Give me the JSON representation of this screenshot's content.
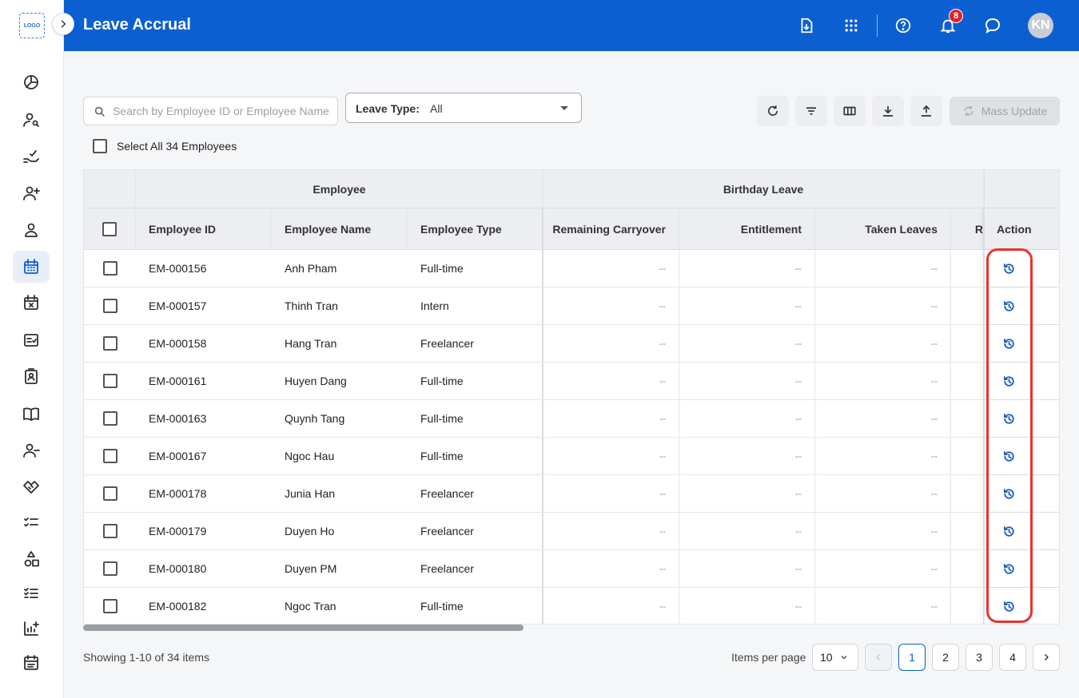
{
  "header": {
    "title": "Leave Accrual",
    "notification_count": "8",
    "avatar_initials": "KN",
    "brand_color": "#0b5fd1"
  },
  "sidebar": {
    "logo_text": "LOGO",
    "items": [
      {
        "icon": "pie-chart-icon"
      },
      {
        "icon": "user-search-icon"
      },
      {
        "icon": "hand-check-icon"
      },
      {
        "icon": "user-add-icon"
      },
      {
        "icon": "user-icon"
      },
      {
        "icon": "calendar-icon",
        "active": true
      },
      {
        "icon": "calendar-cancel-icon"
      },
      {
        "icon": "checklist-icon"
      },
      {
        "icon": "id-badge-icon"
      },
      {
        "icon": "book-icon"
      },
      {
        "icon": "user-remove-icon"
      },
      {
        "icon": "handshake-icon"
      },
      {
        "icon": "task-list-icon"
      },
      {
        "icon": "shapes-icon"
      },
      {
        "icon": "ordered-list-icon"
      },
      {
        "icon": "report-add-icon"
      },
      {
        "icon": "note-icon"
      }
    ]
  },
  "toolbar": {
    "search_placeholder": "Search by Employee ID or Employee Name",
    "leave_type_label": "Leave Type:",
    "leave_type_value": "All",
    "mass_update_label": "Mass Update",
    "select_all_label": "Select All 34 Employees"
  },
  "table": {
    "group_headers": {
      "employee": "Employee",
      "birthday_leave": "Birthday Leave"
    },
    "columns": {
      "employee_id": "Employee ID",
      "employee_name": "Employee Name",
      "employee_type": "Employee Type",
      "remaining_carryover": "Remaining Carryover",
      "entitlement": "Entitlement",
      "taken_leaves": "Taken Leaves",
      "truncated": "R",
      "action": "Action"
    },
    "empty_value": "--",
    "rows": [
      {
        "id": "EM-000156",
        "name": "Anh Pham",
        "type": "Full-time"
      },
      {
        "id": "EM-000157",
        "name": "Thinh Tran",
        "type": "Intern"
      },
      {
        "id": "EM-000158",
        "name": "Hang Tran",
        "type": "Freelancer"
      },
      {
        "id": "EM-000161",
        "name": "Huyen Dang",
        "type": "Full-time"
      },
      {
        "id": "EM-000163",
        "name": "Quynh Tang",
        "type": "Full-time"
      },
      {
        "id": "EM-000167",
        "name": "Ngoc Hau",
        "type": "Full-time"
      },
      {
        "id": "EM-000178",
        "name": "Junia Han",
        "type": "Freelancer"
      },
      {
        "id": "EM-000179",
        "name": "Duyen Ho",
        "type": "Freelancer"
      },
      {
        "id": "EM-000180",
        "name": "Duyen PM",
        "type": "Freelancer"
      },
      {
        "id": "EM-000182",
        "name": "Ngoc Tran",
        "type": "Full-time"
      }
    ],
    "highlight_color": "#e8332a"
  },
  "footer": {
    "showing_text": "Showing 1-10 of 34 items",
    "items_per_page_label": "Items per page",
    "items_per_page_value": "10",
    "pages": [
      "1",
      "2",
      "3",
      "4"
    ],
    "current_page": "1"
  }
}
